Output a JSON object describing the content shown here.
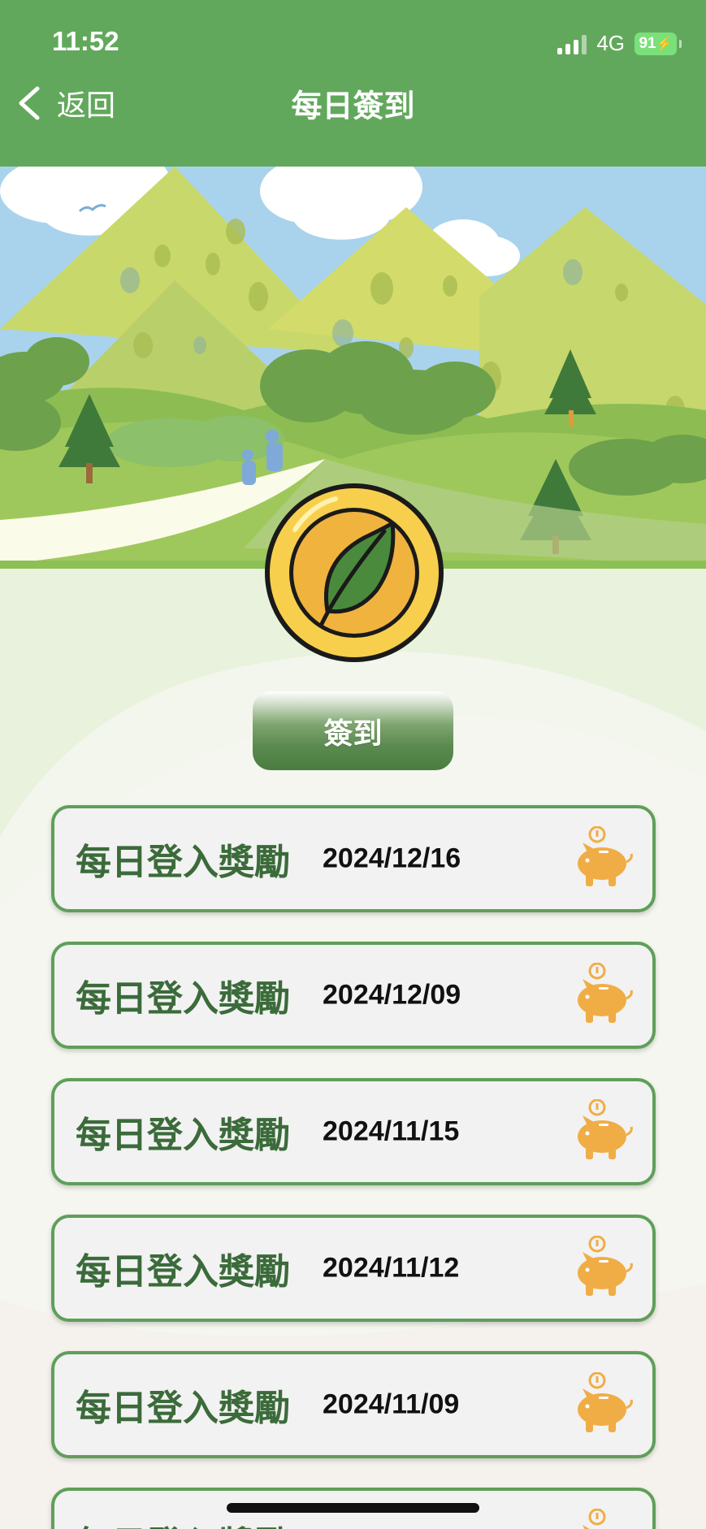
{
  "status_bar": {
    "time": "11:52",
    "network": "4G",
    "battery": "91"
  },
  "nav": {
    "back_label": "返回",
    "title": "每日簽到"
  },
  "checkin": {
    "button_label": "簽到"
  },
  "rewards": [
    {
      "title": "每日登入獎勵",
      "date": "2024/12/16"
    },
    {
      "title": "每日登入獎勵",
      "date": "2024/12/09"
    },
    {
      "title": "每日登入獎勵",
      "date": "2024/11/15"
    },
    {
      "title": "每日登入獎勵",
      "date": "2024/11/12"
    },
    {
      "title": "每日登入獎勵",
      "date": "2024/11/09"
    },
    {
      "title": "每日登入獎勵",
      "date": ""
    }
  ],
  "icons": {
    "back": "chevron-left-icon",
    "coin": "leaf-coin-icon",
    "reward": "piggy-bank-icon"
  },
  "colors": {
    "header": "#62a85c",
    "card_border": "#5f9f59",
    "card_title": "#3b6b3a",
    "piggy": "#f0ad45"
  }
}
